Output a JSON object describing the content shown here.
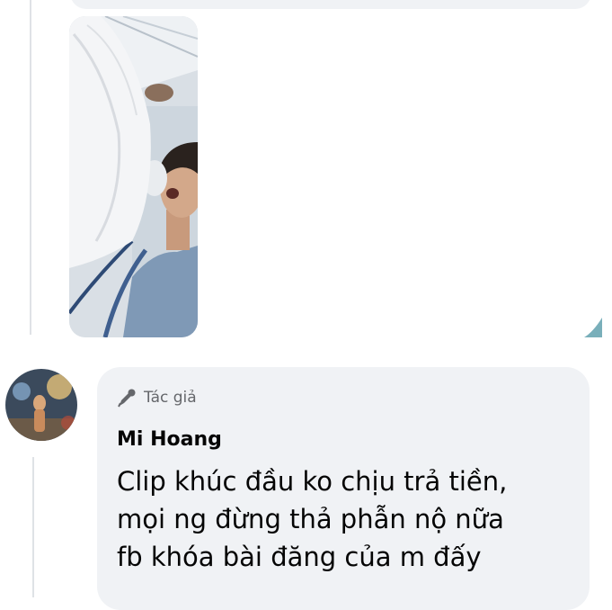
{
  "comment": {
    "badge_label": "Tác giả",
    "author_name": "Mi Hoang",
    "text_lines": [
      "Clip khúc đầu ko chịu trả tiền,",
      "mọi ng đừng thả phẫn nộ nữa",
      "fb khóa bài đăng của m đấy"
    ]
  },
  "icons": {
    "badge": "microphone-pen-icon"
  },
  "colors": {
    "bubble_bg": "#f0f2f5",
    "thread_line": "#dfe2e6",
    "secondary_text": "#65676b",
    "primary_text": "#050505"
  }
}
